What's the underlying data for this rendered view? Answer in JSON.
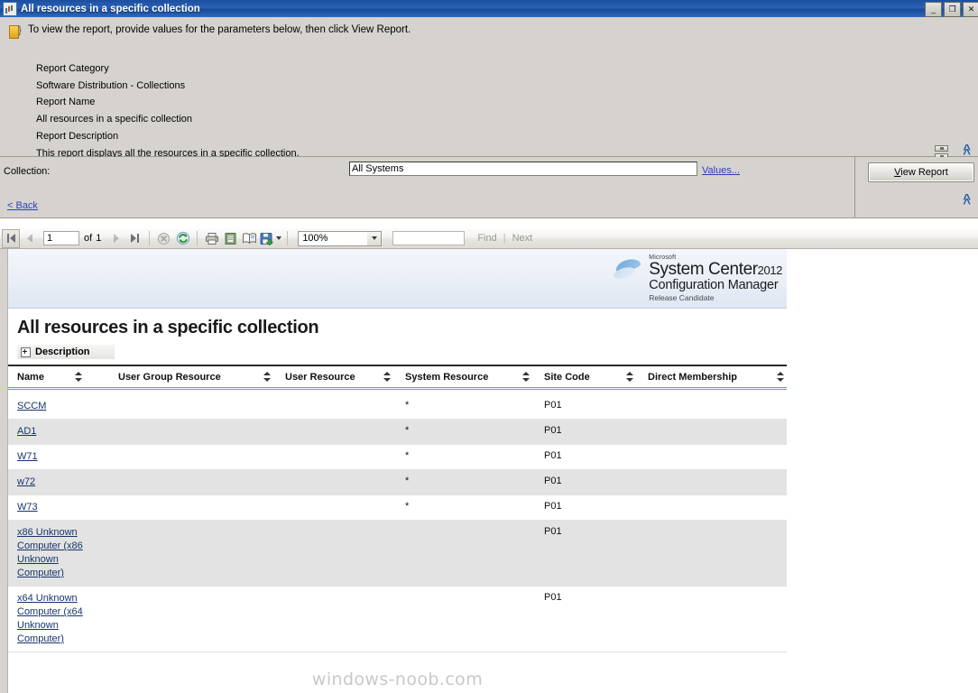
{
  "window": {
    "title": "All resources in a specific collection",
    "icon": "report-chart-icon",
    "minimize_label": "_",
    "restore_label": "❐",
    "close_label": "✕"
  },
  "parameters_panel": {
    "hint": "To view the report, provide values for the parameters below, then click View Report.",
    "hint_icon": "info-note-icon",
    "meta": [
      {
        "label": "Report Category",
        "value": "Software Distribution - Collections"
      },
      {
        "label": "Report Name",
        "value": "All resources in a specific collection"
      },
      {
        "label": "Report Description",
        "value": "This report displays all the resources in a specific collection."
      }
    ],
    "collapse_icon": "double-chevron-up-icon",
    "splitter_icon": "splitter-grip-icon"
  },
  "collection_row": {
    "label": "Collection:",
    "value": "All Systems",
    "placeholder": "",
    "values_link": "Values...",
    "back_link": "< Back",
    "view_report_button": "View Report",
    "view_report_accesskey": "V",
    "collapse_icon": "double-chevron-up-icon"
  },
  "report_toolbar": {
    "first_page_icon": "first-page-icon",
    "prev_page_icon": "previous-page-icon",
    "page_number": "1",
    "of_label": "of",
    "total_pages": "1",
    "next_page_icon": "next-page-icon",
    "last_page_icon": "last-page-icon",
    "stop_icon": "stop-icon",
    "refresh_icon": "refresh-icon",
    "print_icon": "print-icon",
    "print_layout_icon": "print-layout-icon",
    "page_setup_icon": "page-setup-icon",
    "export_icon": "export-save-icon",
    "export_dropdown_icon": "chevron-down-icon",
    "zoom_value": "100%",
    "zoom_dropdown_icon": "chevron-down-icon",
    "find_value": "",
    "find_label": "Find",
    "next_label": "Next",
    "separator": "|"
  },
  "report": {
    "brand": {
      "logo_icon": "system-center-swoosh-icon",
      "microsoft": "Microsoft",
      "line1": "System Center",
      "year": "2012",
      "line2": "Configuration Manager",
      "line3": "Release Candidate"
    },
    "title": "All resources in a specific collection",
    "description_toggle": "Description",
    "description_expand_icon": "expand-plus-icon",
    "watermark": "windows-noob.com",
    "columns": [
      {
        "label": "Name",
        "sort_icon": "sort-toggle-icon"
      },
      {
        "label": "User Group Resource",
        "sort_icon": "sort-toggle-icon"
      },
      {
        "label": "User Resource",
        "sort_icon": "sort-toggle-icon"
      },
      {
        "label": "System Resource",
        "sort_icon": "sort-toggle-icon"
      },
      {
        "label": "Site Code",
        "sort_icon": "sort-toggle-icon"
      },
      {
        "label": "Direct Membership",
        "sort_icon": "sort-toggle-icon"
      }
    ],
    "rows": [
      {
        "name": "SCCM",
        "user_group_resource": "",
        "user_resource": "",
        "system_resource": "*",
        "site_code": "P01",
        "direct_membership": ""
      },
      {
        "name": "AD1",
        "user_group_resource": "",
        "user_resource": "",
        "system_resource": "*",
        "site_code": "P01",
        "direct_membership": ""
      },
      {
        "name": "W71",
        "user_group_resource": "",
        "user_resource": "",
        "system_resource": "*",
        "site_code": "P01",
        "direct_membership": ""
      },
      {
        "name": "w72",
        "user_group_resource": "",
        "user_resource": "",
        "system_resource": "*",
        "site_code": "P01",
        "direct_membership": ""
      },
      {
        "name": "W73",
        "user_group_resource": "",
        "user_resource": "",
        "system_resource": "*",
        "site_code": "P01",
        "direct_membership": ""
      },
      {
        "name": "x86 Unknown Computer (x86 Unknown Computer)",
        "user_group_resource": "",
        "user_resource": "",
        "system_resource": "",
        "site_code": "P01",
        "direct_membership": ""
      },
      {
        "name": "x64 Unknown Computer (x64 Unknown Computer)",
        "user_group_resource": "",
        "user_resource": "",
        "system_resource": "",
        "site_code": "P01",
        "direct_membership": ""
      }
    ]
  },
  "colors": {
    "titlebar": "#2a62b8",
    "panel": "#d6d3ce",
    "link": "#2a3fc4",
    "report_link": "#16356b",
    "accent_chevron": "#2a5fa8",
    "row_alt": "#e3e3e3",
    "header_rule": "#6f93c6"
  }
}
